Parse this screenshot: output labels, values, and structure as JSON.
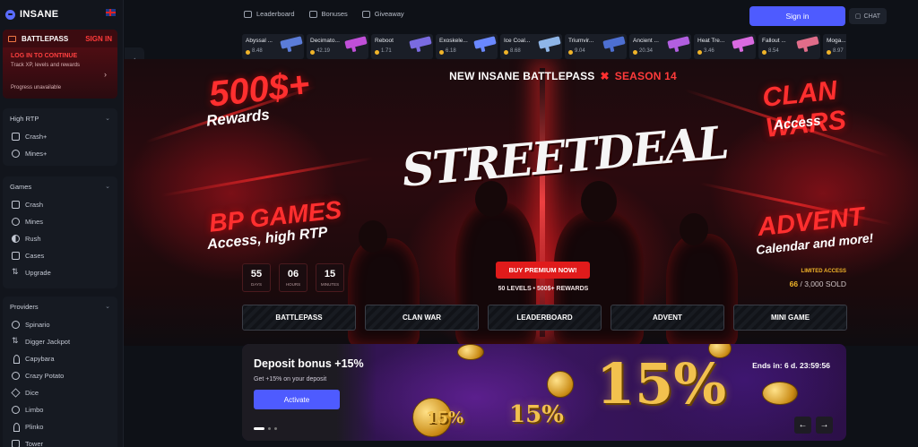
{
  "brand": {
    "name": "INSANE"
  },
  "sidebar": {
    "battlepass": {
      "title": "BATTLEPASS",
      "signin": "SIGN IN",
      "login": "LOG IN TO CONTINUE",
      "desc": "Track XP, levels and rewards",
      "progress": "Progress unavailable"
    },
    "groups": [
      {
        "title": "High RTP",
        "items": [
          {
            "label": "Crash+",
            "icon": "crash-icon"
          },
          {
            "label": "Mines+",
            "icon": "mines-icon"
          }
        ]
      },
      {
        "title": "Games",
        "items": [
          {
            "label": "Crash",
            "icon": "crash-icon"
          },
          {
            "label": "Mines",
            "icon": "mines-icon"
          },
          {
            "label": "Rush",
            "icon": "rush-icon"
          },
          {
            "label": "Cases",
            "icon": "cases-icon"
          },
          {
            "label": "Upgrade",
            "icon": "upgrade-icon"
          }
        ]
      },
      {
        "title": "Providers",
        "items": [
          {
            "label": "Spinario",
            "icon": "spinario-icon"
          },
          {
            "label": "Digger Jackpot",
            "icon": "pickaxe-icon"
          },
          {
            "label": "Capybara",
            "icon": "capybara-icon"
          },
          {
            "label": "Crazy Potato",
            "icon": "potato-icon"
          },
          {
            "label": "Dice",
            "icon": "dice-icon"
          },
          {
            "label": "Limbo",
            "icon": "limbo-icon"
          },
          {
            "label": "Plinko",
            "icon": "plinko-icon"
          },
          {
            "label": "Tower",
            "icon": "tower-icon"
          }
        ]
      }
    ]
  },
  "topnav": {
    "leaderboard": "Leaderboard",
    "bonuses": "Bonuses",
    "giveaway": "Giveaway",
    "signin": "Sign in",
    "chat": "CHAT"
  },
  "drops": [
    {
      "name": "Abyssal ...",
      "price": "8.48",
      "color": "#5b7cd8"
    },
    {
      "name": "Decimato...",
      "price": "42.19",
      "color": "#c04fd8"
    },
    {
      "name": "Reboot",
      "price": "1.71",
      "color": "#7a6be0"
    },
    {
      "name": "Exoskele...",
      "price": "6.18",
      "color": "#6a88ff"
    },
    {
      "name": "Ice Coal...",
      "price": "8.68",
      "color": "#8fb6e8"
    },
    {
      "name": "Triumvir...",
      "price": "9.04",
      "color": "#4d6fd1"
    },
    {
      "name": "Ancient ...",
      "price": "20.34",
      "color": "#b25fe0"
    },
    {
      "name": "Heat Tre...",
      "price": "3.46",
      "color": "#d96ae0"
    },
    {
      "name": "Fallout ...",
      "price": "8.54",
      "color": "#e06d8a"
    },
    {
      "name": "Moga...",
      "price": "8.97",
      "color": "#888"
    }
  ],
  "hero": {
    "title": "NEW INSANE BATTLEPASS",
    "season": "SEASON 14",
    "logo": "STREETDEAL",
    "promo_left_1": "500$+",
    "promo_left_1_sub": "Rewards",
    "promo_left_2": "BP GAMES",
    "promo_left_2_sub": "Access, high RTP",
    "promo_right_1": "CLAN WARS",
    "promo_right_1_sub": "Access",
    "promo_right_2": "ADVENT",
    "promo_right_2_sub": "Calendar and more!",
    "countdown": [
      {
        "n": "55",
        "l": "DAYS"
      },
      {
        "n": "06",
        "l": "HOURS"
      },
      {
        "n": "15",
        "l": "MINUTES"
      }
    ],
    "buy": "BUY PREMIUM NOW!",
    "levels": "50 LEVELS • 500$+ REWARDS",
    "limited": "LIMITED ACCESS",
    "sold_count": "66",
    "sold_rest": "/ 3,000 SOLD",
    "tabs": [
      "BATTLEPASS",
      "CLAN WAR",
      "LEADERBOARD",
      "ADVENT",
      "MINI GAME"
    ]
  },
  "banner": {
    "title": "Deposit bonus +15%",
    "sub": "Get +15% on your deposit",
    "button": "Activate",
    "ends": "Ends in: 6 d. 23:59:56",
    "pct_big": "15%",
    "pct_mid": "15%",
    "pct_small": "15%"
  }
}
